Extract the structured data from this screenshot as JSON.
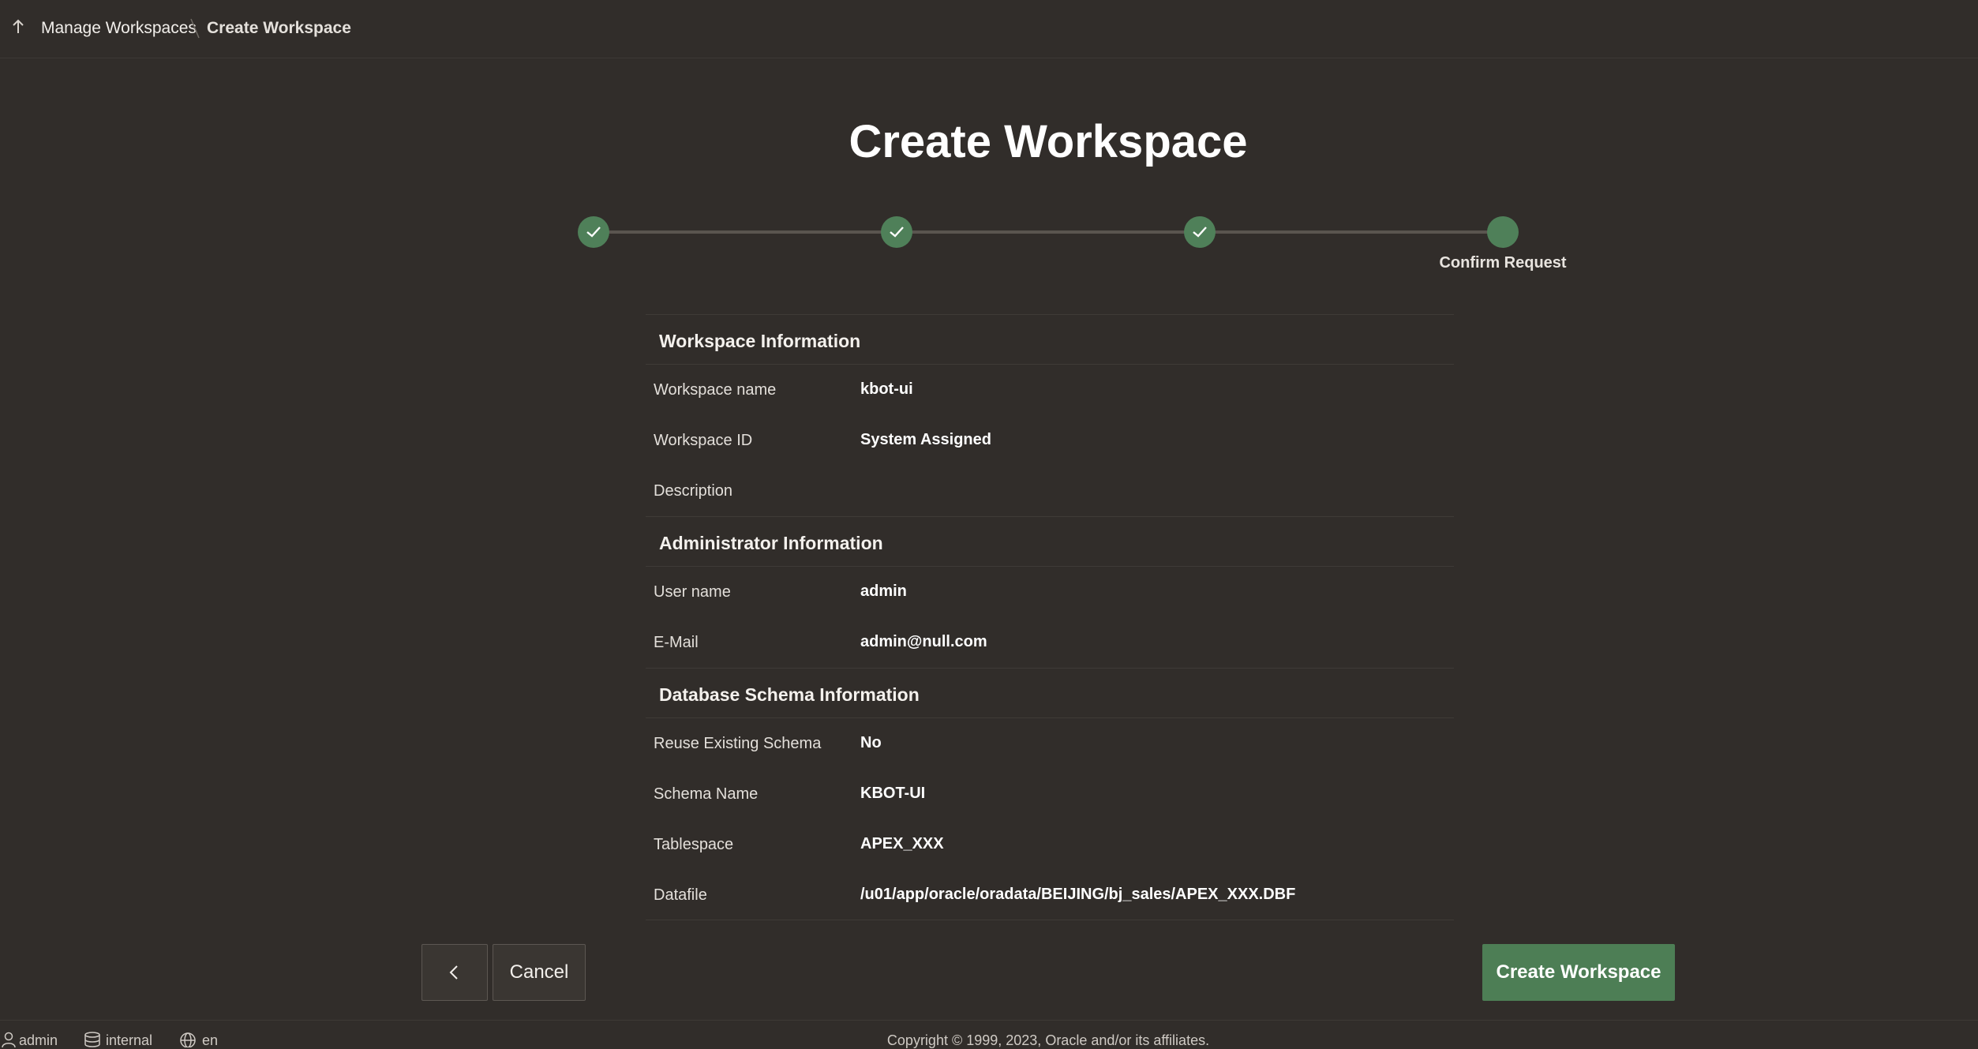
{
  "breadcrumb": {
    "parent": "Manage Workspaces",
    "current": "Create Workspace"
  },
  "page": {
    "title": "Create Workspace"
  },
  "wizard": {
    "steps": [
      {
        "status": "complete"
      },
      {
        "status": "complete"
      },
      {
        "status": "complete"
      },
      {
        "status": "current",
        "label": "Confirm Request"
      }
    ],
    "accent_color": "#4f8059"
  },
  "sections": {
    "workspace": {
      "heading": "Workspace Information",
      "rows": [
        {
          "label": "Workspace name",
          "value": "kbot-ui"
        },
        {
          "label": "Workspace ID",
          "value": "System Assigned"
        },
        {
          "label": "Description",
          "value": ""
        }
      ]
    },
    "administrator": {
      "heading": "Administrator Information",
      "rows": [
        {
          "label": "User name",
          "value": "admin"
        },
        {
          "label": "E-Mail",
          "value": "admin@null.com"
        }
      ]
    },
    "schema": {
      "heading": "Database Schema Information",
      "rows": [
        {
          "label": "Reuse Existing Schema",
          "value": "No"
        },
        {
          "label": "Schema Name",
          "value": "KBOT-UI"
        },
        {
          "label": "Tablespace",
          "value": "APEX_XXX"
        },
        {
          "label": "Datafile",
          "value": "/u01/app/oracle/oradata/BEIJING/bj_sales/APEX_XXX.DBF"
        }
      ]
    }
  },
  "buttons": {
    "back_icon": "chevron-left-icon",
    "cancel": "Cancel",
    "create": "Create Workspace"
  },
  "footer": {
    "user": "admin",
    "workspace": "internal",
    "language": "en",
    "copyright": "Copyright © 1999, 2023, Oracle and/or its affiliates."
  }
}
